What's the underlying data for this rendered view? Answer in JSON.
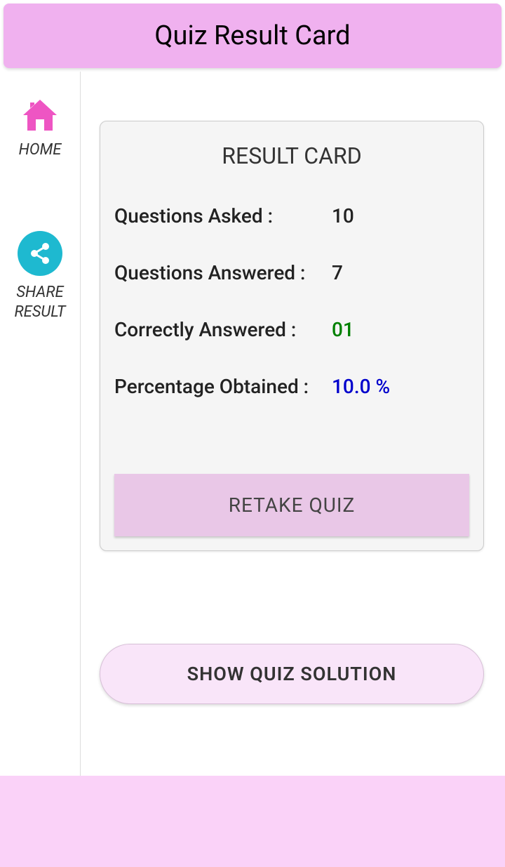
{
  "header": {
    "title": "Quiz Result Card"
  },
  "sidebar": {
    "home_label": "HOME",
    "share_label": "SHARE RESULT"
  },
  "result_card": {
    "title": "RESULT CARD",
    "rows": [
      {
        "label": "Questions Asked :",
        "value": "10",
        "color": ""
      },
      {
        "label": "Questions Answered :",
        "value": "7",
        "color": ""
      },
      {
        "label": "Correctly Answered :",
        "value": "01",
        "color": "green"
      },
      {
        "label": "Percentage Obtained :",
        "value": "10.0 %",
        "color": "blue"
      }
    ],
    "retake_label": "RETAKE QUIZ"
  },
  "solution_button_label": "SHOW QUIZ SOLUTION"
}
